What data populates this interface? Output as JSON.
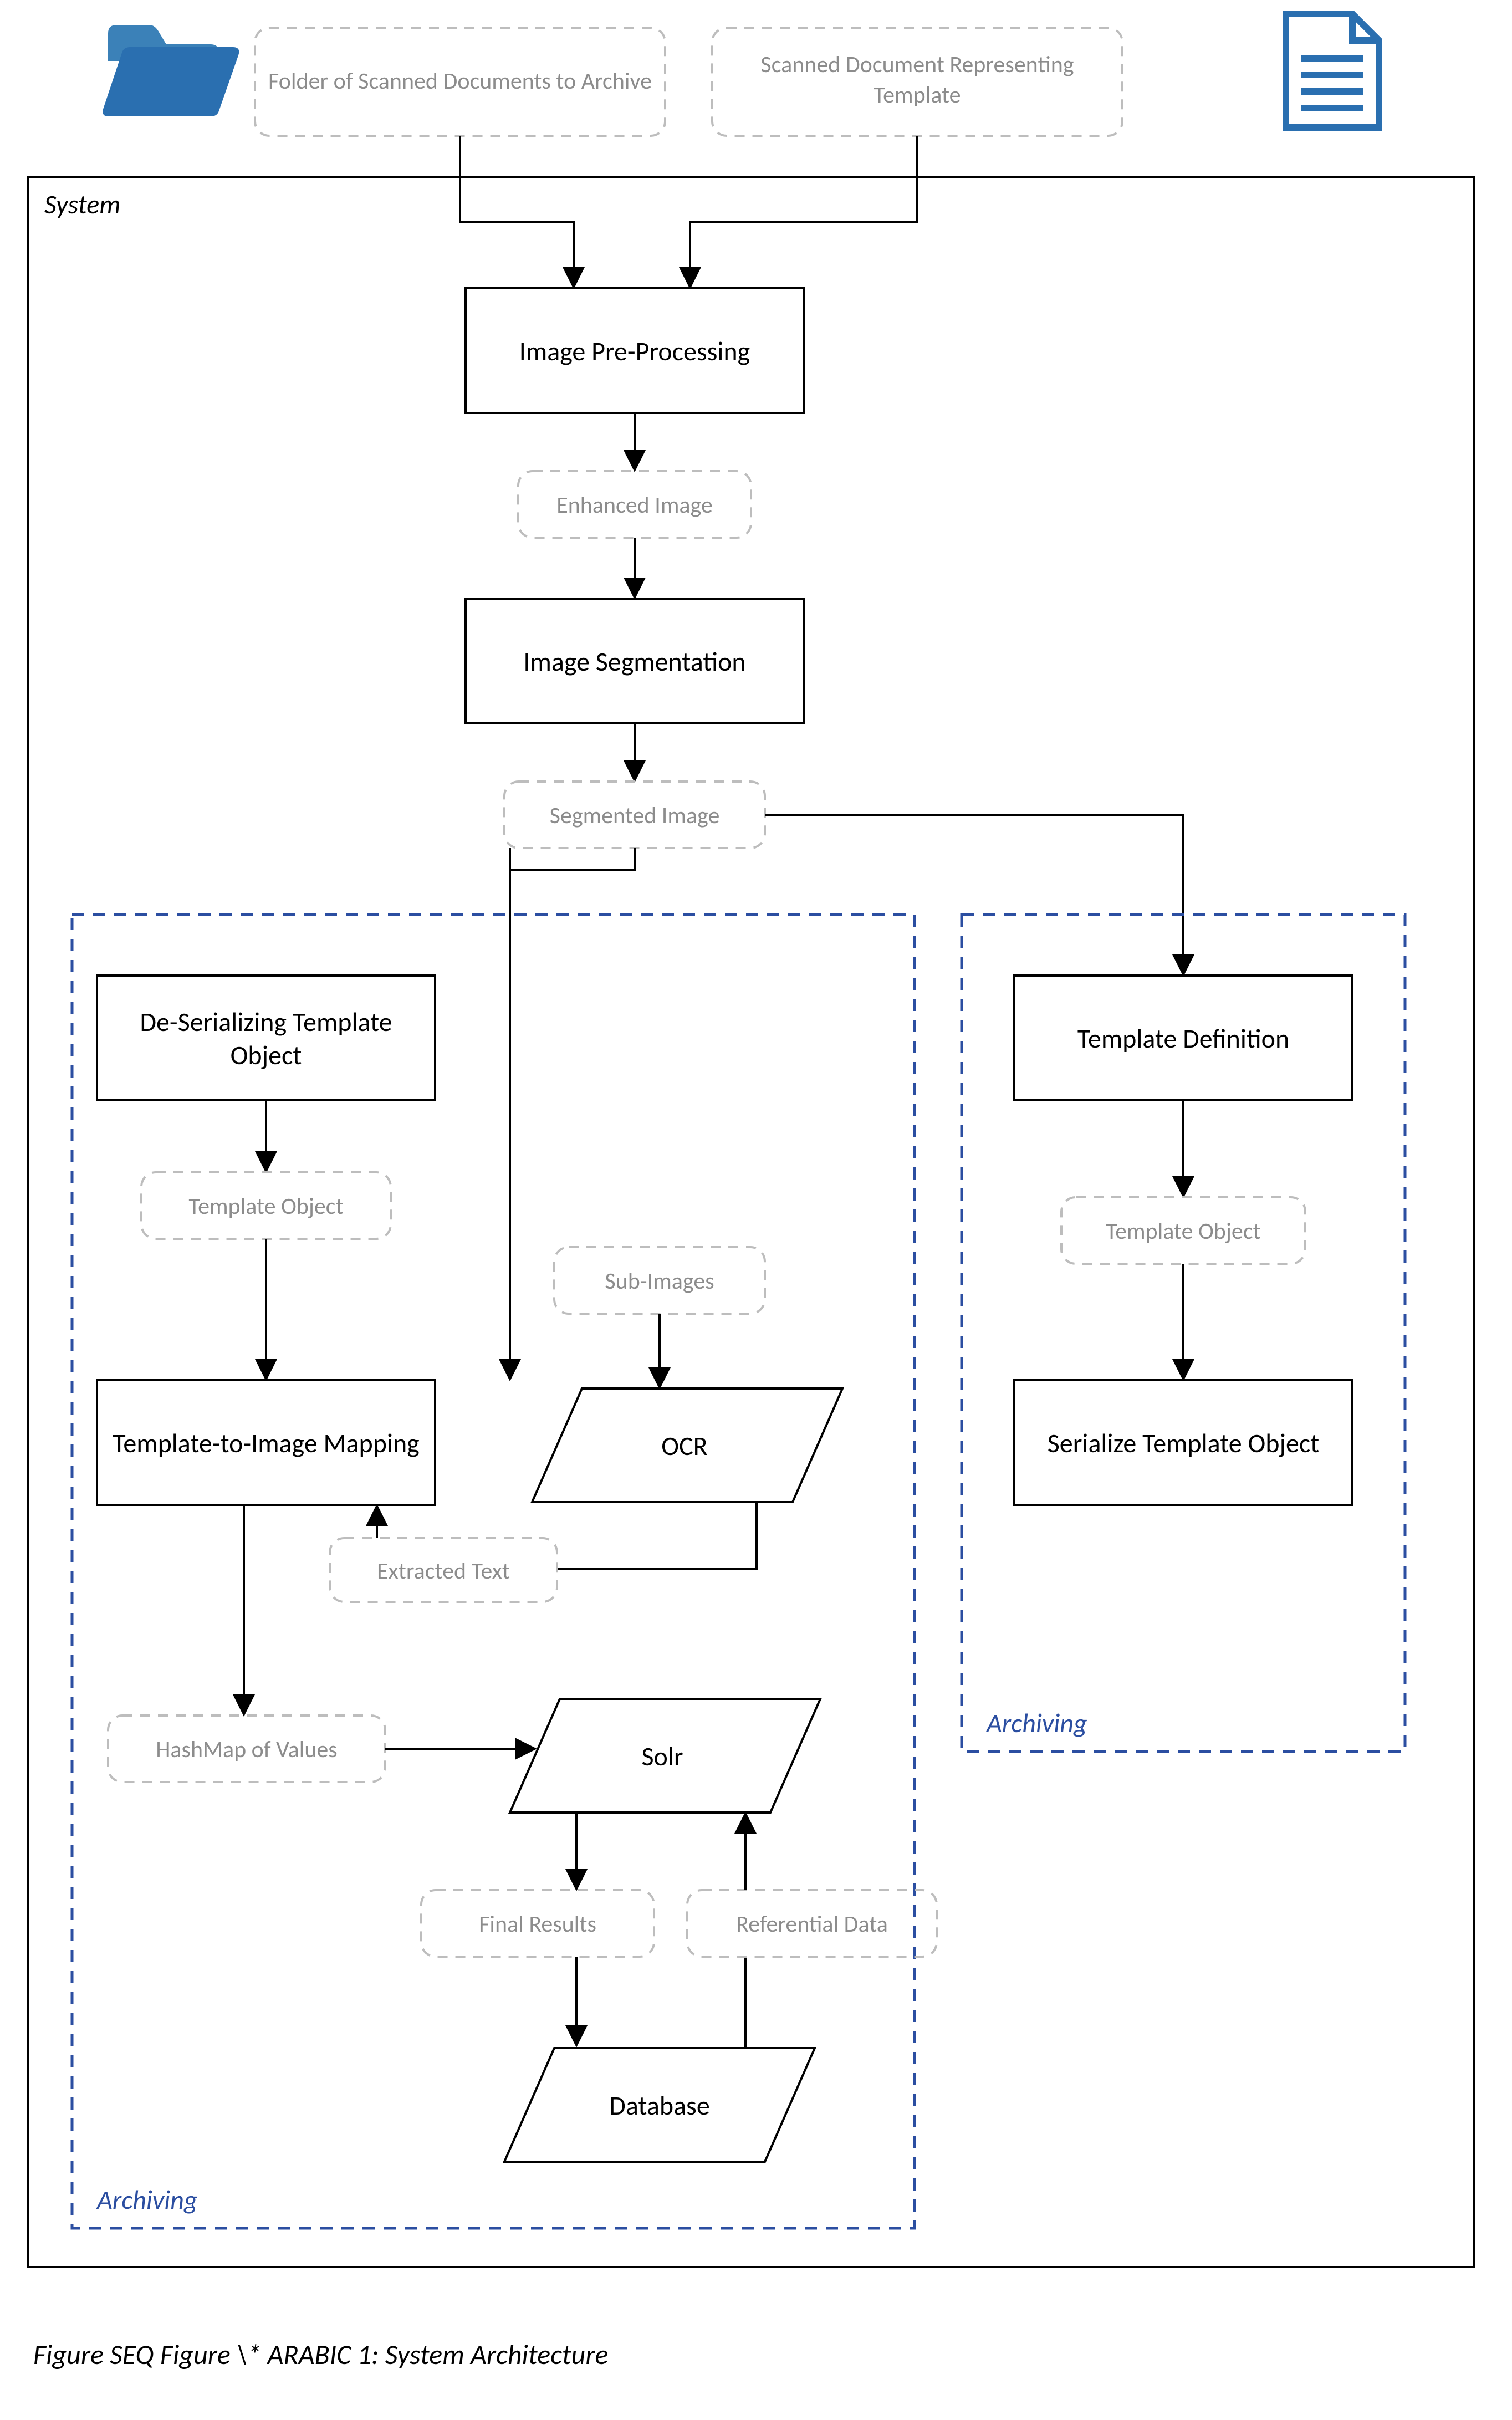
{
  "inputs": {
    "folder_label": "Folder of Scanned Documents to Archive",
    "doc_label": "Scanned Document Representing Template"
  },
  "system_label": "System",
  "proc": {
    "preprocessing": "Image Pre-Processing",
    "segmentation": "Image Segmentation",
    "deserialize": "De-Serializing Template Object",
    "mapping": "Template-to-Image Mapping",
    "ocr": "OCR",
    "solr": "Solr",
    "database": "Database",
    "template_def": "Template Definition",
    "serialize": "Serialize Template Object"
  },
  "data_labels": {
    "enhanced_image": "Enhanced Image",
    "segmented_image": "Segmented Image",
    "template_object_left": "Template Object",
    "template_object_right": "Template Object",
    "sub_images": "Sub-Images",
    "extracted_text": "Extracted Text",
    "hashmap": "HashMap of Values",
    "final_results": "Final Results",
    "referential_data": "Referential Data"
  },
  "region_labels": {
    "archiving_left": "Archiving",
    "archiving_right": "Archiving"
  },
  "caption": "Figure  SEQ Figure \\* ARABIC 1: System Architecture",
  "colors": {
    "icon_blue": "#2a6fb0",
    "dash_blue": "#2b4ea1",
    "dash_grey": "#bdbdbd",
    "text_grey": "#8c8c8c"
  }
}
